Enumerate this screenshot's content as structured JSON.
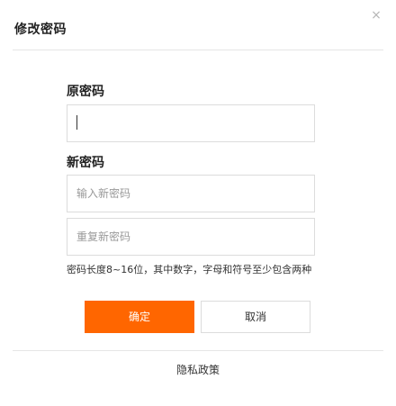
{
  "dialog": {
    "title": "修改密码",
    "close_symbol": "×"
  },
  "form": {
    "old_password_label": "原密码",
    "old_password_value": "",
    "new_password_label": "新密码",
    "new_password_placeholder": "输入新密码",
    "repeat_password_placeholder": "重复新密码",
    "hint": "密码长度8~16位，其中数字，字母和符号至少包含两种"
  },
  "buttons": {
    "confirm_label": "确定",
    "cancel_label": "取消"
  },
  "footer": {
    "privacy_link": "隐私政策"
  },
  "colors": {
    "primary": "#ff6600",
    "border": "#dcdcdc",
    "divider": "#e5e5e5"
  },
  "icons": {
    "close": "close-icon"
  }
}
